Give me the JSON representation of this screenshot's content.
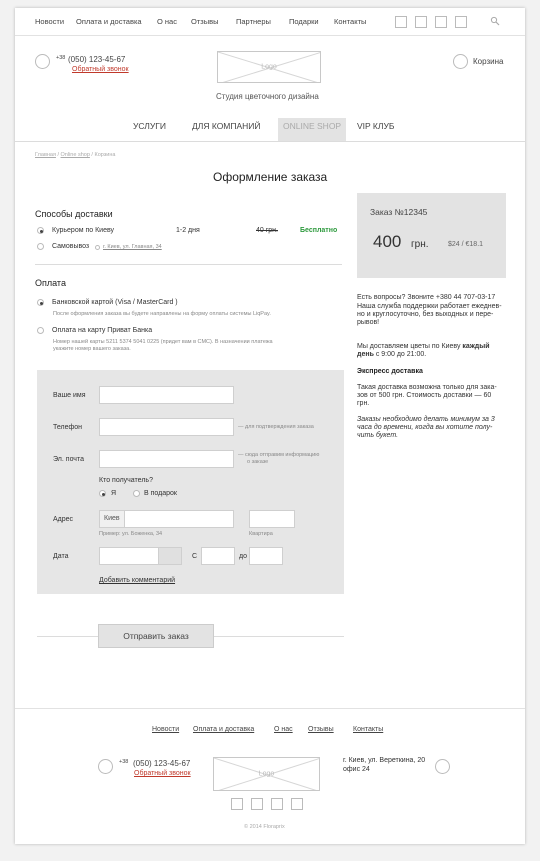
{
  "top_nav": {
    "links": [
      "Новости",
      "Оплата и доставка",
      "О нас",
      "Отзывы",
      "Партнеры",
      "Подарки",
      "Контакты"
    ],
    "search_icon": "search-icon"
  },
  "header": {
    "phone_prefix": "+38",
    "phone": "(050) 123-45-67",
    "callback": "Обратный звонок",
    "logo": "Logo",
    "tagline": "Студия цветочного дизайна",
    "cart": "Корзина"
  },
  "main_nav": [
    "УСЛУГИ",
    "ДЛЯ КОМПАНИЙ",
    "ONLINE SHOP",
    "VIP КЛУБ"
  ],
  "breadcrumb": {
    "home": "Главная",
    "shop": "Online shop",
    "current": "Корзина",
    "sep": "/"
  },
  "page_title": "Оформление заказа",
  "delivery": {
    "title": "Способы доставки",
    "courier": {
      "label": "Курьером по Киеву",
      "days": "1-2 дня",
      "old_price": "40 грн.",
      "price": "Бесплатно"
    },
    "pickup": {
      "label": "Самовывоз",
      "address": "г. Киев, ул. Главная, 34"
    }
  },
  "payment": {
    "title": "Оплата",
    "card": {
      "label": "Банковской картой (Visa / MasterCard )",
      "note": "После оформления заказа вы будете направлены на форму оплаты системы LiqPay."
    },
    "privat": {
      "label": "Оплата на карту Приват Банка",
      "note1": "Номер нашей карты 5211 5374 5041 0225 (придет вам в СМС). В назначении платежа",
      "note2": "укажите номер вашего заказа."
    }
  },
  "form": {
    "name_label": "Ваше имя",
    "phone_label": "Телефон",
    "phone_hint": "— для подтверждения заказа",
    "email_label": "Эл. почта",
    "email_hint1": "— сюда отправим информацию",
    "email_hint2": "о заказе",
    "recipient_q": "Кто получатель?",
    "recipient_me": "Я",
    "recipient_gift": "В подарок",
    "address_label": "Адрес",
    "city": "Киев",
    "address_example": "Пример: ул. Боженка, 34",
    "apartment": "Квартира",
    "date_label": "Дата",
    "from": "С",
    "to": "до",
    "add_comment": "Добавить комментарий"
  },
  "submit": "Отправить заказ",
  "order": {
    "number": "Заказ №12345",
    "amount": "400",
    "currency": "грн.",
    "alt_prices": "$24 / €18.1"
  },
  "side_info": {
    "support_1": "Есть вопросы? Звоните +380 44 707-03-17",
    "support_2": "Наша служба поддержки работает ежеднев-",
    "support_3": "но и круглосуточно, без выходных и пере-",
    "support_4": "рывов!",
    "delivery_1": "Мы доставляем цветы по Киеву",
    "delivery_bold1": "каждый",
    "delivery_bold2": "день",
    "delivery_2": "с 9:00 до 21:00.",
    "express_title": "Экспресс доставка",
    "express_1": "Такая доставка возможна только для зака-",
    "express_2": "зов от 500 грн. Стоимость доставки — 60",
    "express_3": "грн.",
    "italic_1": "Заказы необходимо делать минимум за 3",
    "italic_2": "часа до времени, когда вы хотите полу-",
    "italic_3": "чить букет."
  },
  "footer": {
    "links": [
      "Новости",
      "Оплата и доставка",
      "О нас",
      "Отзывы",
      "Контакты"
    ],
    "phone_prefix": "+38",
    "phone": "(050) 123-45-67",
    "callback": "Обратный звонок",
    "logo": "Logo",
    "address_1": "г. Киев, ул. Вереткина, 20",
    "address_2": "офис 24",
    "copyright": "© 2014 Floraprix"
  },
  "colors": {
    "green": "#2e9a3e",
    "red": "#c0392b",
    "panel": "#e6e6e6"
  }
}
